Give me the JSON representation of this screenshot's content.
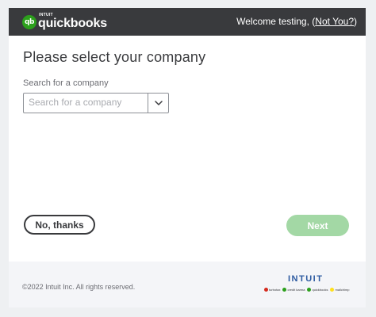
{
  "header": {
    "brand_small": "INTUIT",
    "brand": "quickbooks",
    "logo_mark": "qb",
    "welcome_text": "Welcome testing, (",
    "not_you_link": "Not You?",
    "welcome_close": ")"
  },
  "main": {
    "title": "Please select your company",
    "search_label": "Search for a company",
    "search_placeholder": "Search for a company",
    "search_value": ""
  },
  "actions": {
    "no_thanks_label": "No, thanks",
    "next_label": "Next"
  },
  "footer": {
    "copyright": "©2022 Intuit Inc. All rights reserved.",
    "intuit_brand": "INTUIT",
    "products": [
      {
        "name": "turbotax",
        "color": "#d52b1e"
      },
      {
        "name": "credit karma",
        "color": "#2ca01c"
      },
      {
        "name": "quickbooks",
        "color": "#2ca01c"
      },
      {
        "name": "mailchimp",
        "color": "#ffe01b"
      }
    ]
  },
  "colors": {
    "header_bg": "#393a3d",
    "brand_green": "#2ca01c",
    "next_disabled": "#a3d8a5"
  }
}
